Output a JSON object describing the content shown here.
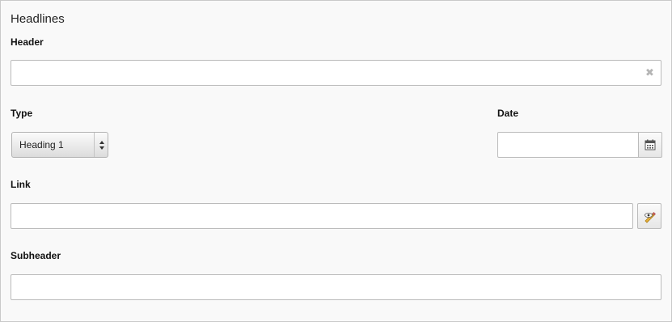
{
  "section": {
    "title": "Headlines"
  },
  "header_field": {
    "label": "Header",
    "value": "",
    "clear_icon": "close-icon"
  },
  "type_field": {
    "label": "Type",
    "selected": "Heading 1"
  },
  "date_field": {
    "label": "Date",
    "value": "",
    "icon": "calendar-icon"
  },
  "link_field": {
    "label": "Link",
    "value": "",
    "icon": "link-wizard-icon"
  },
  "subheader_field": {
    "label": "Subheader",
    "value": ""
  },
  "colors": {
    "panel_bg": "#f9f9f9",
    "border": "#c9c9c9"
  }
}
